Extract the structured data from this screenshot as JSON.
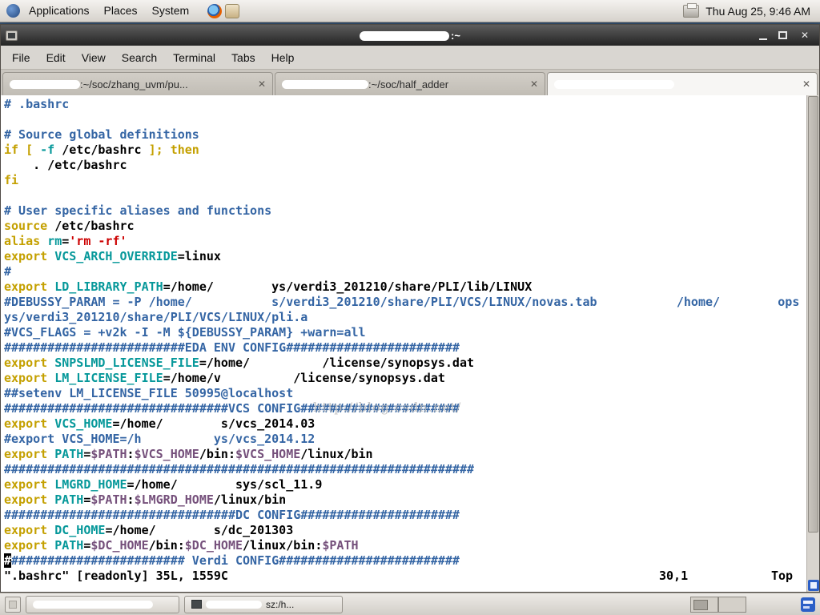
{
  "colors": {
    "comment": "#3465a4",
    "keyword": "#c4a000",
    "ident": "#06989a",
    "string": "#cc0000",
    "variable": "#75507b",
    "text": "#000000"
  },
  "icons": {
    "close": "✕",
    "close_tab": "✕"
  },
  "top_panel": {
    "menus": [
      "Applications",
      "Places",
      "System"
    ],
    "clock": "Thu Aug 25, 9:46 AM"
  },
  "window": {
    "title_suffix": ":~",
    "menubar": [
      "File",
      "Edit",
      "View",
      "Search",
      "Terminal",
      "Tabs",
      "Help"
    ],
    "tabs": [
      {
        "label": ":~/soc/zhang_uvm/pu...",
        "active": false
      },
      {
        "label": ":~/soc/half_adder",
        "active": false
      },
      {
        "label": "",
        "active": true
      }
    ]
  },
  "terminal": {
    "lines": [
      [
        [
          "b",
          "# .bashrc"
        ]
      ],
      [],
      [
        [
          "b",
          "# Source global definitions"
        ]
      ],
      [
        [
          "o",
          "if [ "
        ],
        [
          "t",
          "-f"
        ],
        [
          "k",
          " /etc/bashrc "
        ],
        [
          "o",
          "]; then"
        ]
      ],
      [
        [
          "k",
          "    . /etc/bashrc"
        ]
      ],
      [
        [
          "o",
          "fi"
        ]
      ],
      [],
      [
        [
          "b",
          "# User specific aliases and functions"
        ]
      ],
      [
        [
          "o",
          "source"
        ],
        [
          "k",
          " /etc/bashrc"
        ]
      ],
      [
        [
          "o",
          "alias "
        ],
        [
          "t",
          "rm"
        ],
        [
          "k",
          "="
        ],
        [
          "r",
          "'rm -rf'"
        ]
      ],
      [
        [
          "o",
          "export "
        ],
        [
          "t",
          "VCS_ARCH_OVERRIDE"
        ],
        [
          "k",
          "=linux"
        ]
      ],
      [
        [
          "b",
          "#"
        ]
      ],
      [
        [
          "o",
          "export "
        ],
        [
          "t",
          "LD_LIBRARY_PATH"
        ],
        [
          "k",
          "=/home/"
        ],
        [
          "g",
          8
        ],
        [
          "k",
          "ys/verdi3_201210/share/PLI/lib/LINUX"
        ]
      ],
      [
        [
          "b",
          "#DEBUSSY_PARAM = -P /home/"
        ],
        [
          "g",
          11
        ],
        [
          "b",
          "s/verdi3_201210/share/PLI/VCS/LINUX/novas.tab"
        ],
        [
          "g",
          11
        ],
        [
          "b",
          "/home/"
        ],
        [
          "g",
          8
        ],
        [
          "b",
          "ops"
        ]
      ],
      [
        [
          "b",
          "ys/verdi3_201210/share/PLI/VCS/LINUX/pli.a"
        ]
      ],
      [
        [
          "b",
          "#VCS_FLAGS = +v2k -I -M ${DEBUSSY_PARAM} +warn=all"
        ]
      ],
      [
        [
          "b",
          "#########################EDA ENV CONFIG########################"
        ]
      ],
      [
        [
          "o",
          "export "
        ],
        [
          "t",
          "SNPSLMD_LICENSE_FILE"
        ],
        [
          "k",
          "=/home/"
        ],
        [
          "g",
          10
        ],
        [
          "k",
          "/license/synopsys.dat"
        ]
      ],
      [
        [
          "o",
          "export "
        ],
        [
          "t",
          "LM_LICENSE_FILE"
        ],
        [
          "k",
          "=/home/v"
        ],
        [
          "g",
          10
        ],
        [
          "k",
          "/license/synopsys.dat"
        ]
      ],
      [
        [
          "b",
          "##setenv LM_LICENSE_FILE 50995@localhost"
        ]
      ],
      [
        [
          "b",
          "###############################VCS CONFIG######################"
        ]
      ],
      [
        [
          "o",
          "export "
        ],
        [
          "t",
          "VCS_HOME"
        ],
        [
          "k",
          "=/home/"
        ],
        [
          "g",
          8
        ],
        [
          "k",
          "s/vcs_2014.03"
        ]
      ],
      [
        [
          "b",
          "#export VCS_HOME=/h"
        ],
        [
          "g",
          10
        ],
        [
          "b",
          "ys/vcs_2014.12"
        ]
      ],
      [
        [
          "o",
          "export "
        ],
        [
          "t",
          "PATH"
        ],
        [
          "k",
          "="
        ],
        [
          "p",
          "$PATH"
        ],
        [
          "k",
          ":"
        ],
        [
          "p",
          "$VCS_HOME"
        ],
        [
          "k",
          "/bin:"
        ],
        [
          "p",
          "$VCS_HOME"
        ],
        [
          "k",
          "/linux/bin"
        ]
      ],
      [
        [
          "b",
          "#################################################################"
        ]
      ],
      [
        [
          "o",
          "export "
        ],
        [
          "t",
          "LMGRD_HOME"
        ],
        [
          "k",
          "=/home/"
        ],
        [
          "g",
          8
        ],
        [
          "k",
          "sys/scl_11.9"
        ]
      ],
      [
        [
          "o",
          "export "
        ],
        [
          "t",
          "PATH"
        ],
        [
          "k",
          "="
        ],
        [
          "p",
          "$PATH"
        ],
        [
          "k",
          ":"
        ],
        [
          "p",
          "$LMGRD_HOME"
        ],
        [
          "k",
          "/linux/bin"
        ]
      ],
      [
        [
          "b",
          "################################DC CONFIG######################"
        ]
      ],
      [
        [
          "o",
          "export "
        ],
        [
          "t",
          "DC_HOME"
        ],
        [
          "k",
          "=/home/"
        ],
        [
          "g",
          8
        ],
        [
          "k",
          "s/dc_201303"
        ]
      ],
      [
        [
          "o",
          "export "
        ],
        [
          "t",
          "PATH"
        ],
        [
          "k",
          "="
        ],
        [
          "p",
          "$DC_HOME"
        ],
        [
          "k",
          "/bin:"
        ],
        [
          "p",
          "$DC_HOME"
        ],
        [
          "k",
          "/linux/bin:"
        ],
        [
          "p",
          "$PATH"
        ]
      ],
      [
        [
          "cur",
          "#"
        ],
        [
          "b",
          "######################## Verdi CONFIG#########################"
        ]
      ]
    ],
    "status": {
      "file_info": "\".bashrc\" [readonly] 35L, 1559C",
      "cursor_pos": "30,1",
      "scroll_pos": "Top"
    }
  },
  "watermark": "http://blog.csdn.net/",
  "taskbar": {
    "buttons": [
      {
        "label": ""
      },
      {
        "label": "sz:/h..."
      }
    ]
  }
}
